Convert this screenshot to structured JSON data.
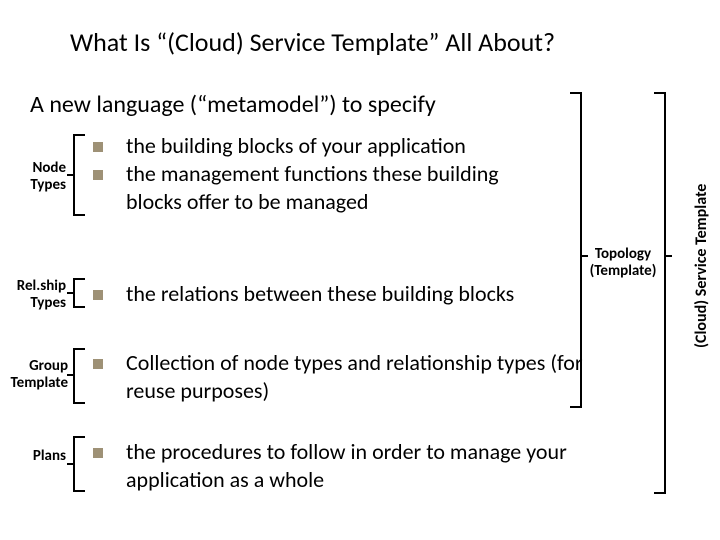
{
  "title": "What Is “(Cloud) Service Template” All About?",
  "subtitle": "A new language (“metamodel”) to specify",
  "bullets": {
    "b1": "the building blocks of your application",
    "b2": "the management functions these building blocks offer to be managed",
    "b3": "the relations between these building blocks",
    "b4": "Collection of node types and relationship types (for reuse purposes)",
    "b5": "the procedures to follow in order to manage your application as a whole"
  },
  "labels": {
    "nodeTypes1": "Node",
    "nodeTypes2": "Types",
    "relTypes1": "Rel.ship",
    "relTypes2": "Types",
    "group1": "Group",
    "group2": "Template",
    "plans": "Plans",
    "topo1": "Topology",
    "topo2": "(Template)",
    "vertical": "(Cloud) Service Template"
  }
}
